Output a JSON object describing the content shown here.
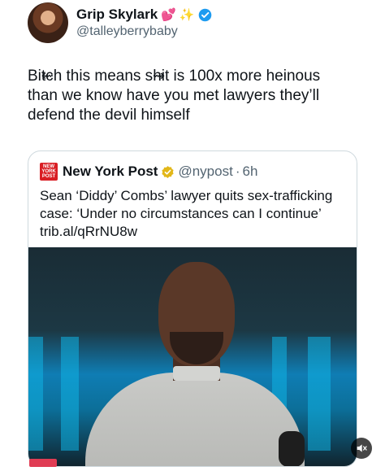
{
  "tweet": {
    "user": {
      "name": "Grip Skylark",
      "emoji_1": "💕",
      "emoji_2": "✨",
      "handle": "@talleyberrybaby"
    },
    "text_line1_prefix": "Bi",
    "text_line1_censor1": "tc",
    "text_line1_mid": "h this means s",
    "text_line1_censor2": "hi",
    "text_line1_suffix": "t is 100x more heinous",
    "text_line2": "than we know have you met lawyers they’ll",
    "text_line3": "defend the devil himself",
    "quote": {
      "logo_text": "NEW YORK POST",
      "name": "New York Post",
      "handle": "@nypost",
      "dot": "·",
      "time": "6h",
      "text": "Sean ‘Diddy’ Combs’ lawyer quits sex-trafficking case: ‘Under no circumstances can I continue’ trib.al/qRrNU8w"
    }
  },
  "colors": {
    "text_primary": "#0f1419",
    "text_secondary": "#536471",
    "verified_blue": "#1d9bf0",
    "verified_gold": "#e2b719",
    "nyp_red": "#d91e24"
  },
  "icons": {
    "verified": "verified-icon",
    "gold_verified": "gold-verified-icon",
    "muted_volume": "muted-volume-icon"
  }
}
